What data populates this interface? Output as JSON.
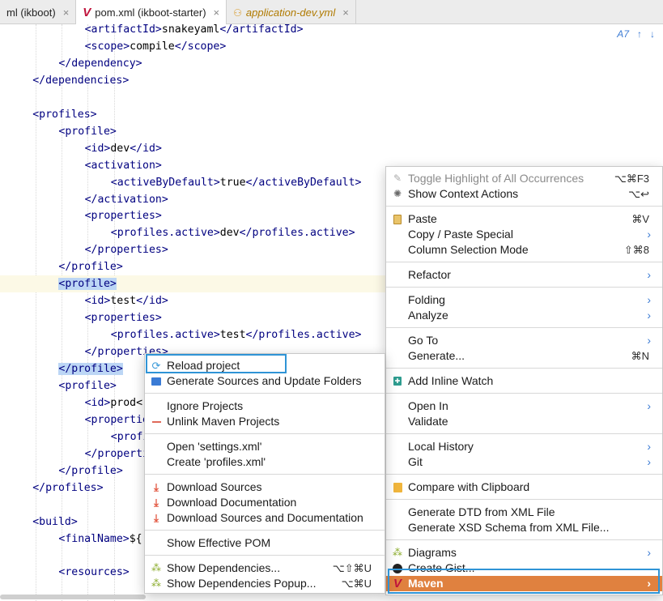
{
  "tabs": [
    {
      "label": "ml (ikboot)",
      "active": false,
      "icon": ""
    },
    {
      "label": "pom.xml (ikboot-starter)",
      "active": true,
      "icon": "maven-v-icon"
    },
    {
      "label": "application-dev.yml",
      "active": false,
      "icon": "yaml-icon"
    }
  ],
  "tab_close_glyph": "×",
  "inspection": {
    "count": "7"
  },
  "code_lines": [
    {
      "indent": 3,
      "parts": [
        [
          "tag",
          "<artifactId>"
        ],
        [
          "text",
          "snakeyaml"
        ],
        [
          "tag",
          "</artifactId>"
        ]
      ]
    },
    {
      "indent": 3,
      "parts": [
        [
          "tag",
          "<scope>"
        ],
        [
          "text",
          "compile"
        ],
        [
          "tag",
          "</scope>"
        ]
      ]
    },
    {
      "indent": 2,
      "parts": [
        [
          "tag",
          "</dependency>"
        ]
      ]
    },
    {
      "indent": 1,
      "parts": [
        [
          "tag",
          "</dependencies>"
        ]
      ]
    },
    {
      "indent": 0,
      "parts": []
    },
    {
      "indent": 1,
      "parts": [
        [
          "tag",
          "<profiles>"
        ]
      ]
    },
    {
      "indent": 2,
      "parts": [
        [
          "tag",
          "<profile>"
        ]
      ]
    },
    {
      "indent": 3,
      "parts": [
        [
          "tag",
          "<id>"
        ],
        [
          "text",
          "dev"
        ],
        [
          "tag",
          "</id>"
        ]
      ]
    },
    {
      "indent": 3,
      "parts": [
        [
          "tag",
          "<activation>"
        ]
      ]
    },
    {
      "indent": 4,
      "parts": [
        [
          "tag",
          "<activeByDefault>"
        ],
        [
          "text",
          "true"
        ],
        [
          "tag",
          "</activeByDefault>"
        ]
      ]
    },
    {
      "indent": 3,
      "parts": [
        [
          "tag",
          "</activation>"
        ]
      ]
    },
    {
      "indent": 3,
      "parts": [
        [
          "tag",
          "<properties>"
        ]
      ]
    },
    {
      "indent": 4,
      "parts": [
        [
          "tag",
          "<profiles.active>"
        ],
        [
          "text",
          "dev"
        ],
        [
          "tag",
          "</profiles.active>"
        ]
      ]
    },
    {
      "indent": 3,
      "parts": [
        [
          "tag",
          "</properties>"
        ]
      ]
    },
    {
      "indent": 2,
      "parts": [
        [
          "tag",
          "</profile>"
        ]
      ]
    },
    {
      "indent": 2,
      "parts": [
        [
          "hl",
          "<profile>"
        ]
      ],
      "caret": true
    },
    {
      "indent": 3,
      "parts": [
        [
          "tag",
          "<id>"
        ],
        [
          "text",
          "test"
        ],
        [
          "tag",
          "</id>"
        ]
      ]
    },
    {
      "indent": 3,
      "parts": [
        [
          "tag",
          "<properties>"
        ]
      ]
    },
    {
      "indent": 4,
      "parts": [
        [
          "tag",
          "<profiles.active>"
        ],
        [
          "text",
          "test"
        ],
        [
          "tag",
          "</profiles.active>"
        ]
      ]
    },
    {
      "indent": 3,
      "parts": [
        [
          "tag",
          "</properties>"
        ]
      ]
    },
    {
      "indent": 2,
      "parts": [
        [
          "hl",
          "</profile>"
        ]
      ]
    },
    {
      "indent": 2,
      "parts": [
        [
          "tag",
          "<profile>"
        ]
      ]
    },
    {
      "indent": 3,
      "parts": [
        [
          "tag",
          "<id>"
        ],
        [
          "text",
          "prod<"
        ]
      ]
    },
    {
      "indent": 3,
      "parts": [
        [
          "tag",
          "<propertie"
        ]
      ]
    },
    {
      "indent": 4,
      "parts": [
        [
          "tag",
          "<profi"
        ]
      ]
    },
    {
      "indent": 3,
      "parts": [
        [
          "tag",
          "</properti"
        ]
      ]
    },
    {
      "indent": 2,
      "parts": [
        [
          "tag",
          "</profile>"
        ]
      ]
    },
    {
      "indent": 1,
      "parts": [
        [
          "tag",
          "</profiles>"
        ]
      ]
    },
    {
      "indent": 0,
      "parts": []
    },
    {
      "indent": 1,
      "parts": [
        [
          "tag",
          "<build>"
        ]
      ]
    },
    {
      "indent": 2,
      "parts": [
        [
          "tag",
          "<finalName>"
        ],
        [
          "text",
          "${"
        ]
      ]
    },
    {
      "indent": 0,
      "parts": []
    },
    {
      "indent": 2,
      "parts": [
        [
          "tag",
          "<resources>"
        ]
      ]
    }
  ],
  "main_menu": [
    {
      "type": "item",
      "label": "Toggle Highlight of All Occurrences",
      "shortcut": "⌥⌘F3",
      "disabled": true,
      "icon": "pencil-icon",
      "name": "toggle-highlight-item"
    },
    {
      "type": "item",
      "label": "Show Context Actions",
      "shortcut": "⌥↩",
      "icon": "bulb-icon",
      "name": "show-context-actions-item"
    },
    {
      "type": "sep"
    },
    {
      "type": "item",
      "label": "Paste",
      "shortcut": "⌘V",
      "icon": "clipboard-icon",
      "name": "paste-item"
    },
    {
      "type": "item",
      "label": "Copy / Paste Special",
      "submenu": true,
      "name": "copy-paste-special-item"
    },
    {
      "type": "item",
      "label": "Column Selection Mode",
      "shortcut": "⇧⌘8",
      "name": "column-selection-item"
    },
    {
      "type": "sep"
    },
    {
      "type": "item",
      "label": "Refactor",
      "submenu": true,
      "name": "refactor-item"
    },
    {
      "type": "sep"
    },
    {
      "type": "item",
      "label": "Folding",
      "submenu": true,
      "name": "folding-item"
    },
    {
      "type": "item",
      "label": "Analyze",
      "submenu": true,
      "name": "analyze-item"
    },
    {
      "type": "sep"
    },
    {
      "type": "item",
      "label": "Go To",
      "submenu": true,
      "name": "goto-item"
    },
    {
      "type": "item",
      "label": "Generate...",
      "shortcut": "⌘N",
      "name": "generate-item"
    },
    {
      "type": "sep"
    },
    {
      "type": "item",
      "label": "Add Inline Watch",
      "icon": "watch-icon",
      "name": "add-inline-watch-item"
    },
    {
      "type": "sep"
    },
    {
      "type": "item",
      "label": "Open In",
      "submenu": true,
      "name": "open-in-item"
    },
    {
      "type": "item",
      "label": "Validate",
      "name": "validate-item"
    },
    {
      "type": "sep"
    },
    {
      "type": "item",
      "label": "Local History",
      "submenu": true,
      "name": "local-history-item"
    },
    {
      "type": "item",
      "label": "Git",
      "submenu": true,
      "name": "git-item"
    },
    {
      "type": "sep"
    },
    {
      "type": "item",
      "label": "Compare with Clipboard",
      "icon": "compare-icon",
      "name": "compare-clipboard-item"
    },
    {
      "type": "sep"
    },
    {
      "type": "item",
      "label": "Generate DTD from XML File",
      "name": "generate-dtd-item"
    },
    {
      "type": "item",
      "label": "Generate XSD Schema from XML File...",
      "name": "generate-xsd-item"
    },
    {
      "type": "sep"
    },
    {
      "type": "item",
      "label": "Diagrams",
      "submenu": true,
      "icon": "diagram-icon",
      "name": "diagrams-item"
    },
    {
      "type": "item",
      "label": "Create Gist...",
      "icon": "github-icon",
      "name": "create-gist-item"
    },
    {
      "type": "item",
      "label": "Maven",
      "submenu": true,
      "icon": "maven-v-icon",
      "highlight": true,
      "name": "maven-item"
    }
  ],
  "maven_menu": [
    {
      "type": "item",
      "label": "Reload project",
      "icon": "reload-icon",
      "name": "reload-project-item"
    },
    {
      "type": "item",
      "label": "Generate Sources and Update Folders",
      "icon": "folder-icon",
      "name": "generate-sources-item"
    },
    {
      "type": "sep"
    },
    {
      "type": "item",
      "label": "Ignore Projects",
      "name": "ignore-projects-item"
    },
    {
      "type": "item",
      "label": "Unlink Maven Projects",
      "icon": "minus-icon",
      "name": "unlink-maven-item"
    },
    {
      "type": "sep"
    },
    {
      "type": "item",
      "label": "Open 'settings.xml'",
      "name": "open-settings-item"
    },
    {
      "type": "item",
      "label": "Create 'profiles.xml'",
      "name": "create-profiles-item"
    },
    {
      "type": "sep"
    },
    {
      "type": "item",
      "label": "Download Sources",
      "icon": "download-icon",
      "name": "download-sources-item"
    },
    {
      "type": "item",
      "label": "Download Documentation",
      "icon": "download-icon",
      "name": "download-docs-item"
    },
    {
      "type": "item",
      "label": "Download Sources and Documentation",
      "icon": "download-icon",
      "name": "download-sources-docs-item"
    },
    {
      "type": "sep"
    },
    {
      "type": "item",
      "label": "Show Effective POM",
      "name": "show-effective-pom-item"
    },
    {
      "type": "sep"
    },
    {
      "type": "item",
      "label": "Show Dependencies...",
      "shortcut": "⌥⇧⌘U",
      "icon": "diagram-icon",
      "name": "show-dependencies-item"
    },
    {
      "type": "item",
      "label": "Show Dependencies Popup...",
      "shortcut": "⌥⌘U",
      "icon": "diagram-icon",
      "name": "show-dependencies-popup-item"
    }
  ],
  "glyphs": {
    "submenu_arrow": "›",
    "inspection_up": "↑",
    "inspection_down": "↓",
    "inspection_icon": "A"
  },
  "colors": {
    "highlight": "#e0813f",
    "focus_outline": "#2f94d6",
    "tag": "#000080"
  }
}
